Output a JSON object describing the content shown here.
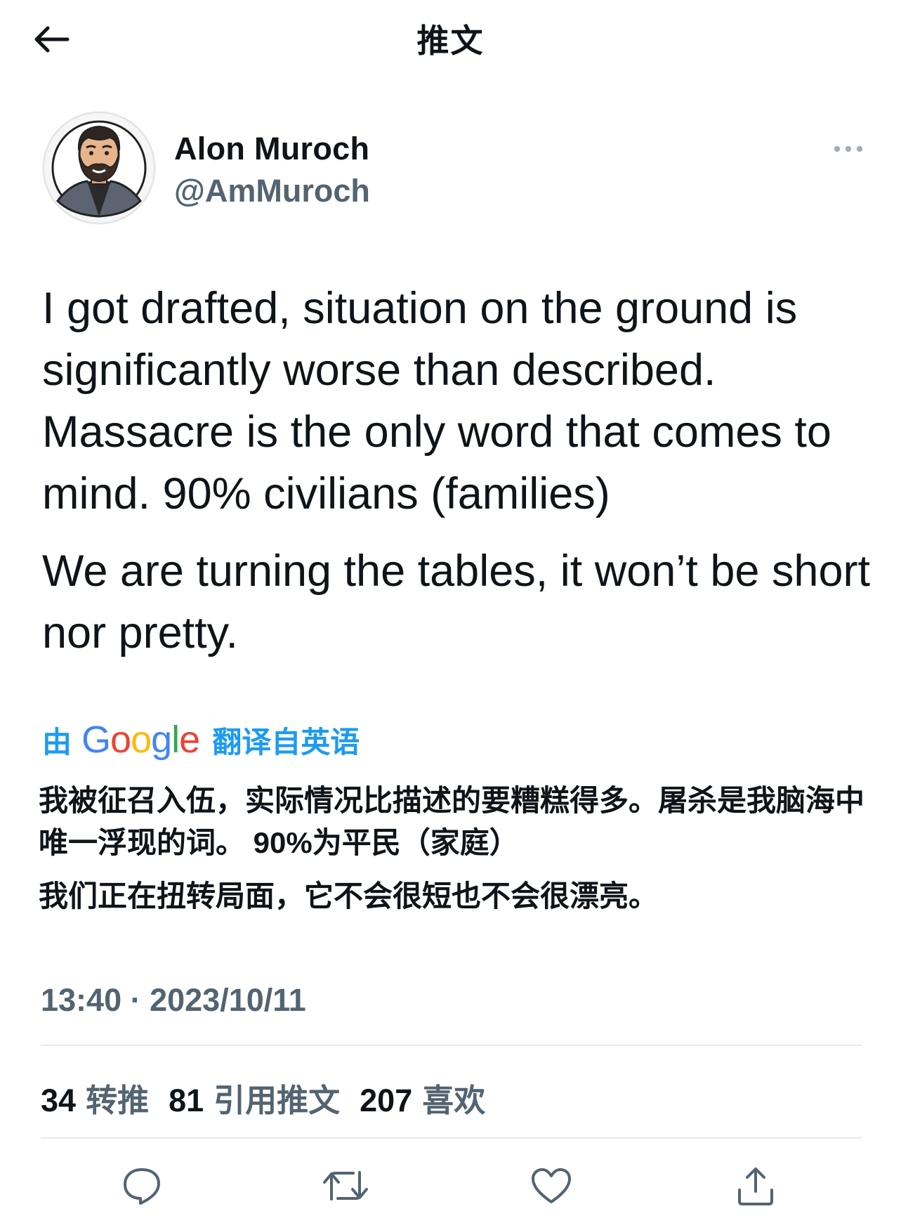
{
  "header": {
    "title": "推文",
    "back_icon": "arrow-left-icon"
  },
  "author": {
    "name": "Alon Muroch",
    "handle": "@AmMuroch",
    "avatar_icon": "avatar-cartoon",
    "more_icon": "more-horizontal-icon"
  },
  "tweet": {
    "paragraphs": [
      "I got drafted, situation on the ground is significantly worse than described. Massacre is the only word that comes to mind. 90% civilians (families)",
      "We are turning the tables, it won’t be short nor pretty."
    ]
  },
  "translation": {
    "by_label": "由",
    "provider": "Google",
    "source_label": "翻译自英语",
    "paragraphs": [
      "我被征召入伍，实际情况比描述的要糟糕得多。屠杀是我脑海中唯一浮现的词。 90%为平民（家庭）",
      "我们正在扭转局面，它不会很短也不会很漂亮。"
    ],
    "google_colors": [
      "#4285F4",
      "#EA4335",
      "#FBBC05",
      "#4285F4",
      "#34A853",
      "#EA4335"
    ]
  },
  "meta": {
    "timestamp": "13:40 · 2023/10/11"
  },
  "stats": {
    "retweets": {
      "count": "34",
      "label": "转推"
    },
    "quotes": {
      "count": "81",
      "label": "引用推文"
    },
    "likes": {
      "count": "207",
      "label": "喜欢"
    }
  },
  "actions": {
    "reply_icon": "reply-icon",
    "retweet_icon": "retweet-icon",
    "like_icon": "heart-icon",
    "share_icon": "share-icon"
  },
  "colors": {
    "text": "#0f1419",
    "secondary": "#536471",
    "link": "#1d9bf0",
    "divider": "#e6e9eb"
  }
}
